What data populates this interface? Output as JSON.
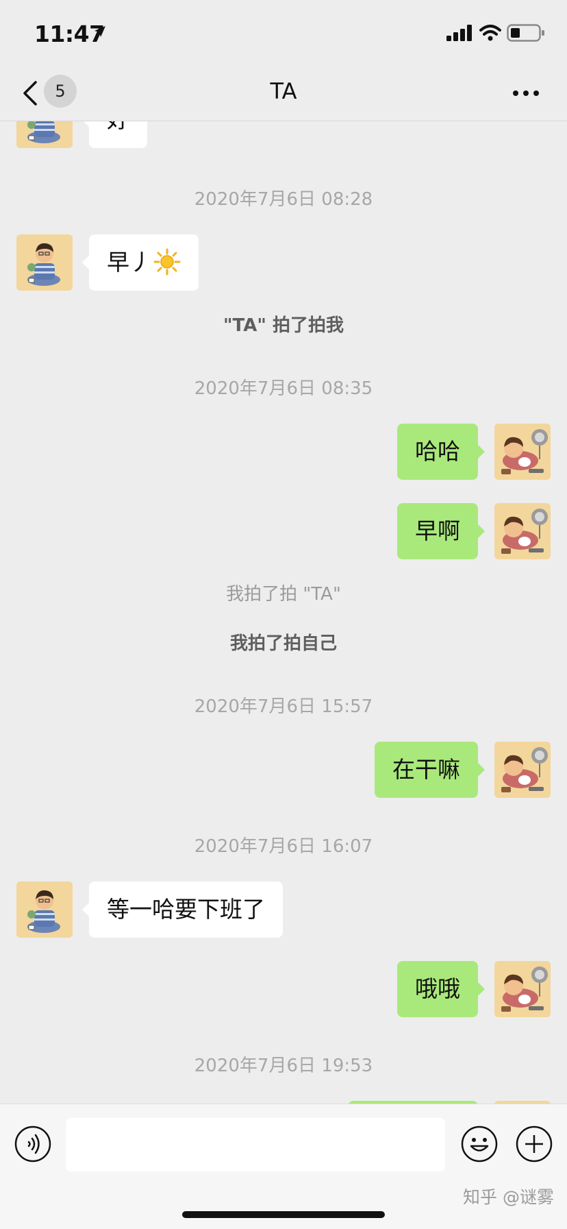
{
  "status_bar": {
    "time": "11:47"
  },
  "nav": {
    "unread_count": "5",
    "title": "TA"
  },
  "messages": {
    "m0": "好",
    "ts1": "2020年7月6日 08:28",
    "m1": "早丿",
    "pat1": "\"TA\" 拍了拍我",
    "ts2": "2020年7月6日 08:35",
    "m2": "哈哈",
    "m3": "早啊",
    "pat2": "我拍了拍 \"TA\"",
    "pat3": "我拍了拍自己",
    "ts3": "2020年7月6日 15:57",
    "m4": "在干嘛",
    "ts4": "2020年7月6日 16:07",
    "m5": "等一哈要下班了",
    "m6": "哦哦",
    "ts5": "2020年7月6日 19:53"
  },
  "input_bar": {
    "value": "",
    "placeholder": ""
  },
  "watermark": "知乎 @谜雾",
  "colors": {
    "background": "#ededed",
    "outgoing_bubble": "#a9e97b",
    "incoming_bubble": "#ffffff"
  },
  "icons": [
    "location-arrow-icon",
    "signal-icon",
    "wifi-icon",
    "battery-icon",
    "back-icon",
    "more-icon",
    "sun-icon",
    "voice-icon",
    "emoji-icon",
    "plus-icon"
  ]
}
